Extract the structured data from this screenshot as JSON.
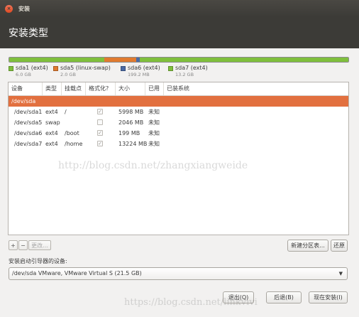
{
  "window": {
    "title": "安装",
    "close_icon": "close-icon"
  },
  "header": {
    "title": "安装类型"
  },
  "partition_bar": {
    "segments": [
      {
        "name": "sda1",
        "color": "#7fbf3c",
        "fraction": 0.28
      },
      {
        "name": "sda5",
        "color": "#e07a2f",
        "fraction": 0.095
      },
      {
        "name": "sda6",
        "color": "#4a6aa5",
        "fraction": 0.009
      },
      {
        "name": "sda7",
        "color": "#7fbf3c",
        "fraction": 0.616
      }
    ]
  },
  "legend": [
    {
      "name": "sda1 (ext4)",
      "size": "6.0 GB",
      "color": "#7fbf3c"
    },
    {
      "name": "sda5 (linux-swap)",
      "size": "2.0 GB",
      "color": "#e07a2f"
    },
    {
      "name": "sda6 (ext4)",
      "size": "199.2 MB",
      "color": "#4a6aa5"
    },
    {
      "name": "sda7 (ext4)",
      "size": "13.2 GB",
      "color": "#7fbf3c"
    }
  ],
  "table": {
    "headers": [
      "设备",
      "类型",
      "挂载点",
      "格式化?",
      "大小",
      "已用",
      "已装系统"
    ],
    "rows": [
      {
        "device": "/dev/sda",
        "type": "",
        "mount": "",
        "format": null,
        "size": "",
        "used": "",
        "system": "",
        "selected": true
      },
      {
        "device": "/dev/sda1",
        "type": "ext4",
        "mount": "/",
        "format": true,
        "size": "5998 MB",
        "used": "未知",
        "system": "",
        "selected": false
      },
      {
        "device": "/dev/sda5",
        "type": "swap",
        "mount": "",
        "format": false,
        "size": "2046 MB",
        "used": "未知",
        "system": "",
        "selected": false
      },
      {
        "device": "/dev/sda6",
        "type": "ext4",
        "mount": "/boot",
        "format": true,
        "size": "199 MB",
        "used": "未知",
        "system": "",
        "selected": false
      },
      {
        "device": "/dev/sda7",
        "type": "ext4",
        "mount": "/home",
        "format": true,
        "size": "13224 MB",
        "used": "未知",
        "system": "",
        "selected": false
      }
    ]
  },
  "table_actions": {
    "add": "+",
    "remove": "−",
    "change": "更改..."
  },
  "table_buttons": {
    "new_table": "新建分区表...",
    "revert": "还原"
  },
  "boot_loader": {
    "label": "安装启动引导器的设备:",
    "value": "/dev/sda   VMware, VMware Virtual S (21.5 GB)"
  },
  "footer": {
    "quit": "退出(Q)",
    "back": "后退(B)",
    "install": "现在安装(I)"
  },
  "watermarks": {
    "center": "http://blog.csdn.net/zhangxiangweide",
    "bottom": "https://blog.csdn.net/linkvivi"
  }
}
